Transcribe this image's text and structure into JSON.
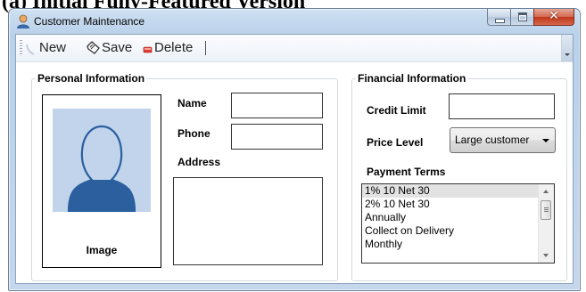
{
  "caption": "(a) Initial Fully-Featured Version",
  "window": {
    "title": "Customer Maintenance"
  },
  "toolbar": {
    "new_label": "New",
    "save_label": "Save",
    "delete_label": "Delete"
  },
  "personal": {
    "group_label": "Personal Information",
    "image_label": "Image",
    "name_label": "Name",
    "phone_label": "Phone",
    "address_label": "Address",
    "name_value": "",
    "phone_value": "",
    "address_value": ""
  },
  "financial": {
    "group_label": "Financial Information",
    "credit_limit_label": "Credit Limit",
    "credit_limit_value": "",
    "price_level_label": "Price Level",
    "price_level_value": "Large customer",
    "payment_terms_label": "Payment Terms",
    "payment_terms": [
      "1% 10 Net 30",
      "2% 10 Net 30",
      "Annually",
      "Collect on Delivery",
      "Monthly"
    ],
    "selected_term_index": 0
  },
  "colors": {
    "window_frame": "#b9d1ea",
    "close_button": "#c1371a",
    "avatar_bg": "#c1d4ec",
    "avatar_silhouette": "#2b5f9e"
  }
}
